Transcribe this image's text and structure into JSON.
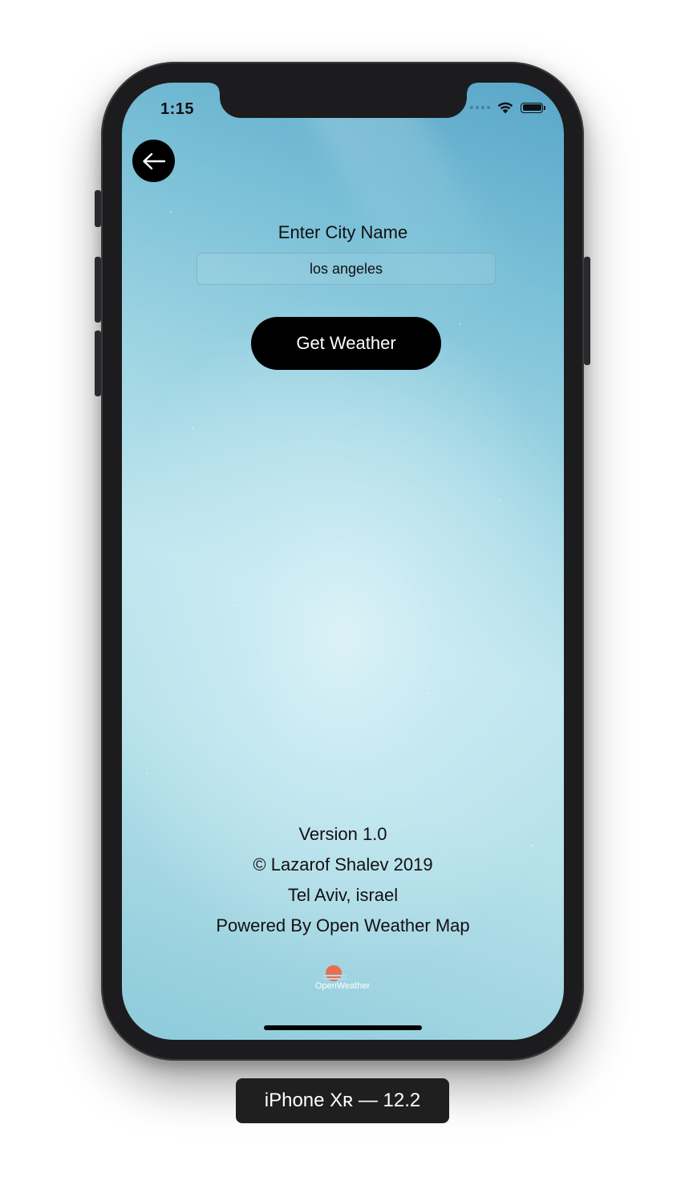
{
  "status_bar": {
    "time": "1:15",
    "icons": [
      "cellular-signal-icon",
      "wifi-icon",
      "battery-icon"
    ]
  },
  "navigation": {
    "back_icon": "arrow-left-icon"
  },
  "form": {
    "label": "Enter City Name",
    "city_value": "los angeles",
    "submit_label": "Get Weather"
  },
  "footer": {
    "version": "Version 1.0",
    "copyright": "© Lazarof Shalev 2019",
    "location": "Tel Aviv, israel",
    "powered_by": "Powered By Open Weather Map",
    "logo_text": "OpenWeather"
  },
  "simulator": {
    "device_label": "iPhone Xʀ — 12.2"
  },
  "colors": {
    "button_bg": "#000000",
    "button_text": "#ffffff",
    "logo_sun": "#e96e50",
    "sky_top": "#5aa6c8",
    "sky_center": "#d6eff5"
  }
}
